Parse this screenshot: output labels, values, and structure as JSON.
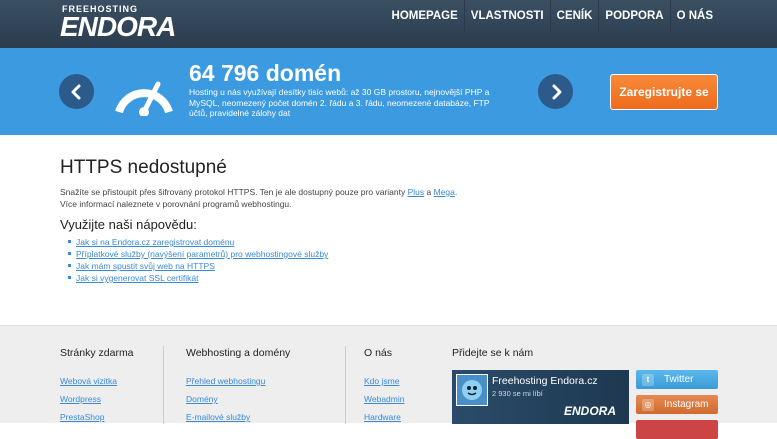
{
  "header": {
    "logo_small": "FREEHOSTING",
    "logo_big": "ENDORA",
    "nav": [
      "HOMEPAGE",
      "VLASTNOSTI",
      "CENÍK",
      "PODPORA",
      "O NÁS"
    ]
  },
  "hero": {
    "title": "64 796 domén",
    "description": "Hosting u nás využívají desítky tisíc webů: až 30 GB prostoru, nejnovější PHP a MySQL, neomezený počet domén 2. řádu a 3. řádu, neomezené databáze, FTP účtů, pravidelné zálohy dat",
    "cta": "Zaregistrujte se"
  },
  "main": {
    "title": "HTTPS nedostupné",
    "para1_before": "Snažíte se přistoupit přes šifrovaný protokol HTTPS. Ten je ale dostupný pouze pro varianty ",
    "para1_link1": "Plus",
    "para1_mid": " a ",
    "para1_link2": "Mega",
    "para1_after": ".",
    "para2": "Více informací naleznete v porovnání programů webhostingu.",
    "help_title": "Využijte naši nápovědu:",
    "help_links": [
      "Jak si na Endora.cz zaregistrovat doménu",
      "Příplatkové služby (navýšení parametrů) pro webhostingové služby",
      "Jak mám spustit svůj web na HTTPS",
      "Jak si vygenerovat SSL certifikát"
    ]
  },
  "footer": {
    "col1": {
      "title": "Stránky zdarma",
      "links": [
        "Webová vizitka",
        "Wordpress",
        "PrestaShop"
      ]
    },
    "col2": {
      "title": "Webhosting a domény",
      "links": [
        "Přehled webhostingu",
        "Domény",
        "E-mailové služby"
      ]
    },
    "col3": {
      "title": "O nás",
      "links": [
        "Kdo jsme",
        "Webadmin",
        "Hardware"
      ]
    },
    "col4": {
      "title": "Přidejte se k nám",
      "fb_name": "Freehosting Endora.cz",
      "fb_count": "2 930 se mi líbí",
      "fb_logo": "ENDORA"
    },
    "social": [
      "Twitter",
      "Instagram"
    ]
  }
}
